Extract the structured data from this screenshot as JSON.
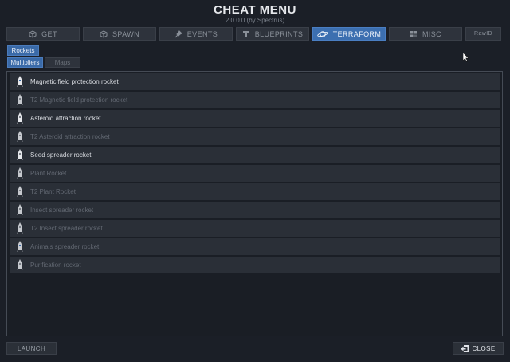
{
  "header": {
    "title": "CHEAT MENU",
    "subtitle": "2.0.0.0 (by Spectrus)"
  },
  "tabs": [
    {
      "label": "GET",
      "icon": "cube-icon",
      "active": false
    },
    {
      "label": "SPAWN",
      "icon": "cube-outline-icon",
      "active": false
    },
    {
      "label": "EVENTS",
      "icon": "pin-icon",
      "active": false
    },
    {
      "label": "BLUEPRINTS",
      "icon": "t-icon",
      "active": false
    },
    {
      "label": "TERRAFORM",
      "icon": "planet-icon",
      "active": true
    },
    {
      "label": "MISC",
      "icon": "grid-icon",
      "active": false
    },
    {
      "label": "RawID",
      "icon": "",
      "active": false
    }
  ],
  "section": {
    "category_label": "Rockets"
  },
  "subtabs": {
    "multipliers_label": "Multipliers",
    "maps_label": "Maps"
  },
  "rockets": [
    {
      "label": "Magnetic field protection rocket",
      "enabled": true
    },
    {
      "label": "T2 Magnetic field protection rocket",
      "enabled": false
    },
    {
      "label": "Asteroid attraction rocket",
      "enabled": true
    },
    {
      "label": "T2 Asteroid attraction rocket",
      "enabled": false
    },
    {
      "label": "Seed spreader rocket",
      "enabled": true
    },
    {
      "label": "Plant Rocket",
      "enabled": false
    },
    {
      "label": "T2 Plant Rocket",
      "enabled": false
    },
    {
      "label": "Insect spreader rocket",
      "enabled": false
    },
    {
      "label": "T2 Insect spreader rocket",
      "enabled": false
    },
    {
      "label": "Animals spreader rocket",
      "enabled": false
    },
    {
      "label": "Purification rocket",
      "enabled": false
    }
  ],
  "footer": {
    "launch_label": "LAUNCH",
    "close_label": "CLOSE"
  },
  "colors": {
    "accent": "#3c6fb0",
    "background": "#1b1f27",
    "row": "#2a2f37"
  }
}
